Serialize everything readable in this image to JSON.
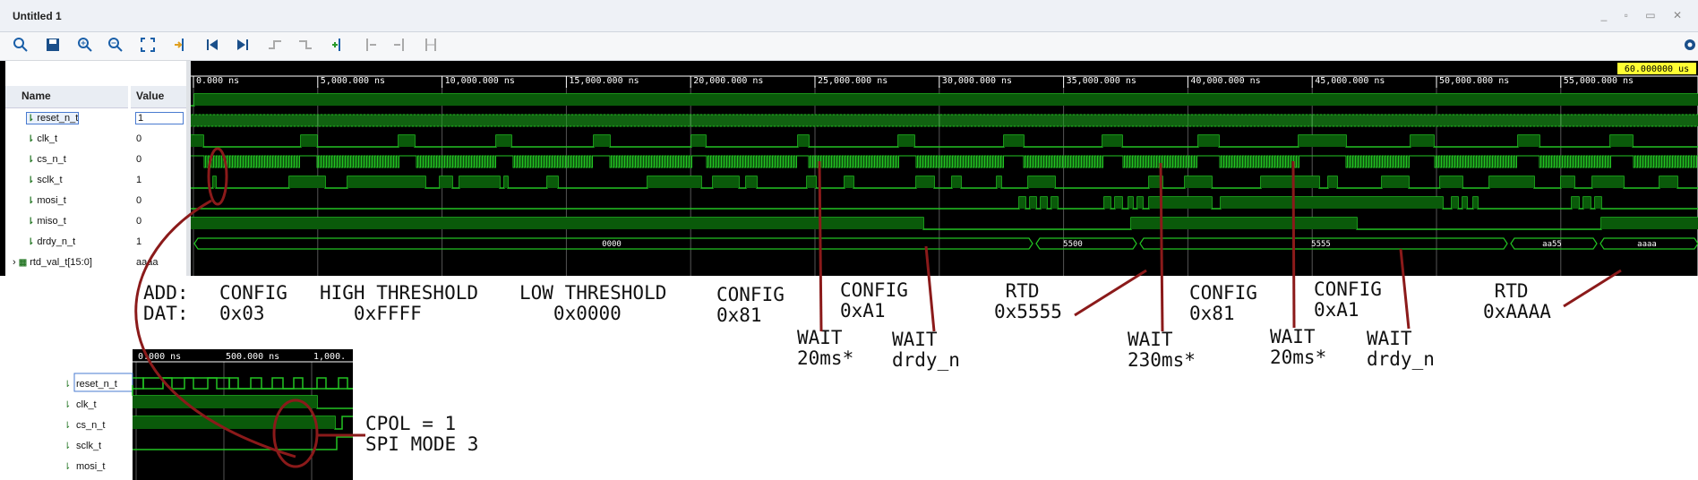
{
  "window": {
    "title": "Untitled 1",
    "controls": "_ ▫ ▭ ✕"
  },
  "toolbar": {
    "items": [
      "search-icon",
      "save-icon",
      "zoom-in-icon",
      "zoom-out-icon",
      "zoom-fit-icon",
      "go-to-cursor-icon",
      "go-to-start-icon",
      "go-to-end-icon",
      "prev-transition-icon",
      "next-transition-icon",
      "add-marker-icon",
      "prev-marker-icon",
      "next-marker-icon",
      "swap-cursors-icon",
      "settings-icon"
    ]
  },
  "header": {
    "name": "Name",
    "value": "Value",
    "cursor": "60.000000 us"
  },
  "timeline": {
    "ticks": [
      "0.000 ns",
      "5,000.000 ns",
      "10,000.000 ns",
      "15,000.000 ns",
      "20,000.000 ns",
      "25,000.000 ns",
      "30,000.000 ns",
      "35,000.000 ns",
      "40,000.000 ns",
      "45,000.000 ns",
      "50,000.000 ns",
      "55,000.000 ns"
    ]
  },
  "signals": [
    {
      "name": "reset_n_t",
      "value": "1",
      "bus": false
    },
    {
      "name": "clk_t",
      "value": "0",
      "bus": false
    },
    {
      "name": "cs_n_t",
      "value": "0",
      "bus": false
    },
    {
      "name": "sclk_t",
      "value": "1",
      "bus": false
    },
    {
      "name": "mosi_t",
      "value": "0",
      "bus": false
    },
    {
      "name": "miso_t",
      "value": "0",
      "bus": false
    },
    {
      "name": "drdy_n_t",
      "value": "1",
      "bus": false
    },
    {
      "name": "rtd_val_t[15:0]",
      "value": "aaaa",
      "bus": true
    }
  ],
  "bus_labels": [
    "0000",
    "5500",
    "5555",
    "aa55",
    "aaaa"
  ],
  "annotations": {
    "add_label": "ADD:",
    "dat_label": "DAT:",
    "config1": "CONFIG\n0x03",
    "high": "HIGH THRESHOLD\n   0xFFFF",
    "low": "LOW THRESHOLD\n   0x0000",
    "config2": "CONFIG\n0x81",
    "config3": "CONFIG\n0xA1",
    "rtd1": " RTD\n0x5555",
    "config4": "CONFIG\n0x81",
    "config5": "CONFIG\n0xA1",
    "rtd2": " RTD\n0xAAAA",
    "wait1": "WAIT\n20ms*",
    "wait2": "WAIT\ndrdy_n",
    "wait3": "WAIT\n230ms*",
    "wait4": "WAIT\n20ms*",
    "wait5": "WAIT\ndrdy_n",
    "cpol": "CPOL = 1\nSPI MODE 3"
  },
  "zoom_inset": {
    "ticks": [
      "0.000 ns",
      "500.000 ns",
      "1,000."
    ],
    "signals": [
      "reset_n_t",
      "clk_t",
      "cs_n_t",
      "sclk_t",
      "mosi_t"
    ]
  }
}
